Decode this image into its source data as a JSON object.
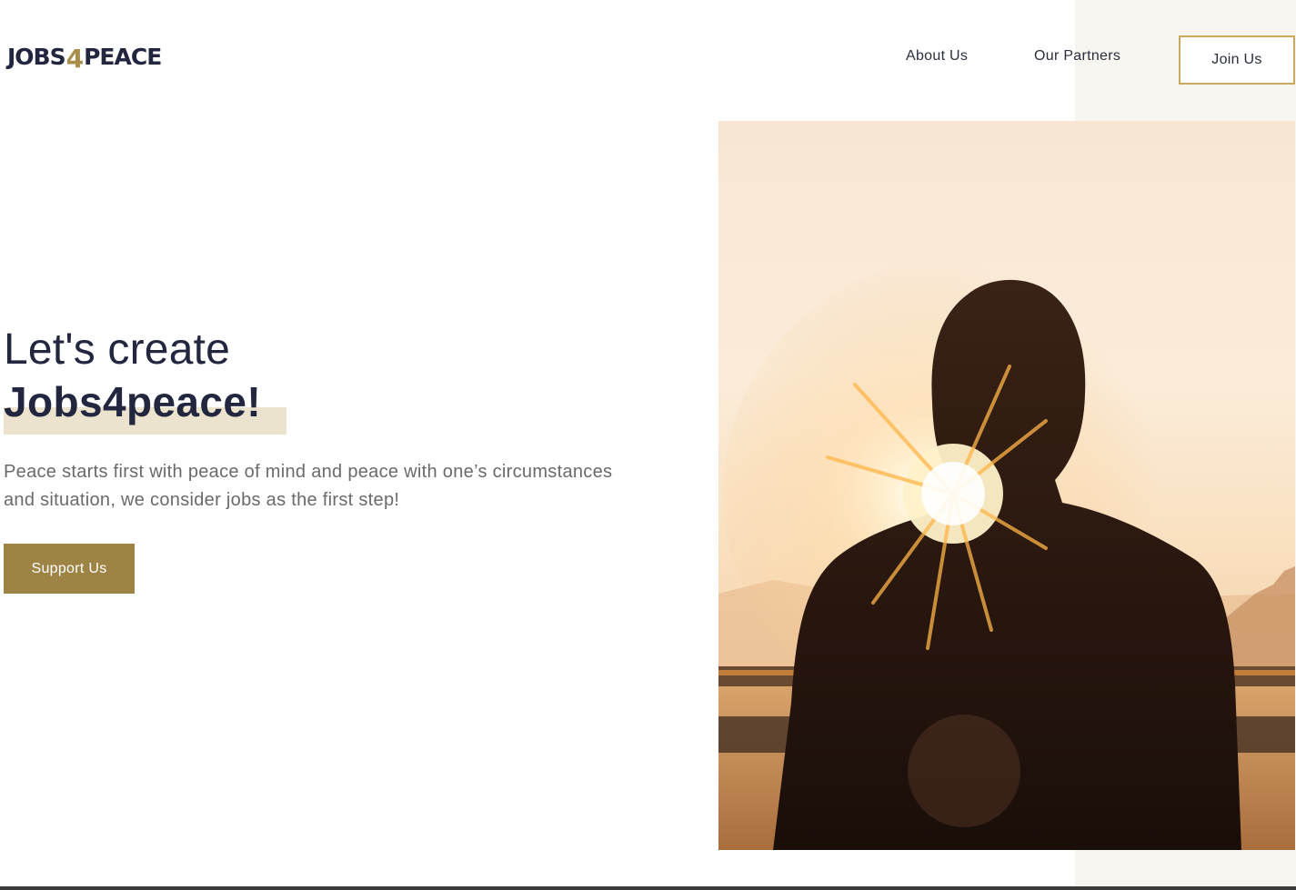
{
  "header": {
    "logo": {
      "part1": "JOBS",
      "part2": "4",
      "part3": "PEACE"
    },
    "nav": {
      "about": "About Us",
      "partners": "Our Partners",
      "join": "Join Us"
    }
  },
  "hero": {
    "line1": "Let's create",
    "line2": "Jobs4peace!",
    "description": "Peace starts first with peace of mind and peace with one’s circumstances and situation, we consider jobs as the first step!",
    "cta": "Support Us",
    "image": "man-facing-sunset-photo"
  },
  "colors": {
    "navy": "#22263f",
    "gold": "#a88d4b",
    "button": "#9d8445",
    "highlight": "#ece3ce",
    "beige_panel": "#f7f5ef"
  }
}
